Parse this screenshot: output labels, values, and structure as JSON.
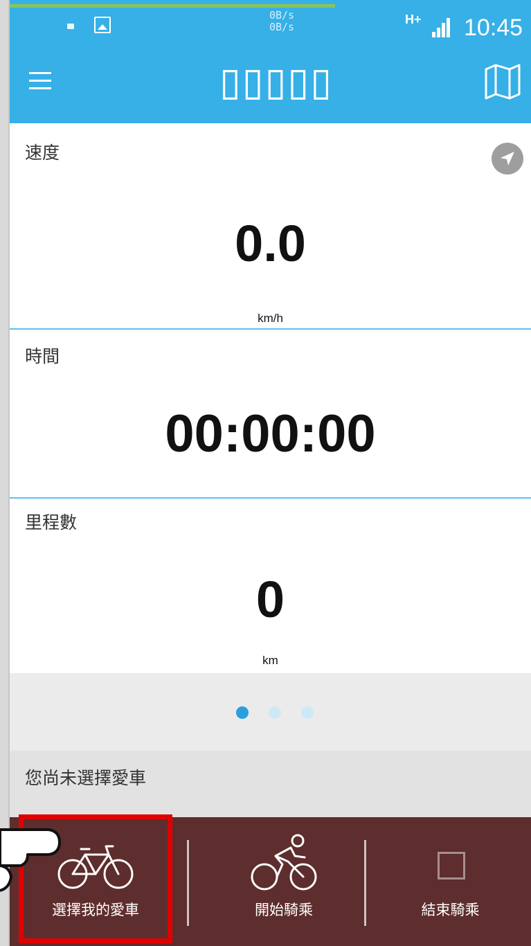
{
  "status_bar": {
    "net_speed_up": "0B/s",
    "net_speed_down": "0B/s",
    "net_type": "H+",
    "time": "10:45"
  },
  "app_bar": {
    "title": "▯▯▯▯▯",
    "menu_icon": "hamburger-menu-icon",
    "map_icon": "folded-map-icon"
  },
  "cards": {
    "speed": {
      "label": "速度",
      "value": "0.0",
      "unit": "km/h"
    },
    "time": {
      "label": "時間",
      "value": "00:00:00"
    },
    "distance": {
      "label": "里程數",
      "value": "0",
      "unit": "km"
    }
  },
  "pager": {
    "count": 3,
    "active_index": 0
  },
  "bike_status": {
    "text": "您尚未選擇愛車"
  },
  "actions": [
    {
      "label": "選擇我的愛車",
      "icon": "bicycle-icon"
    },
    {
      "label": "開始騎乘",
      "icon": "cyclist-icon"
    },
    {
      "label": "結束騎乘",
      "icon": "stop-square-icon"
    }
  ],
  "colors": {
    "app_bar": "#36b0e6",
    "divider": "#5cc1ea",
    "pager_active": "#2b9fde",
    "pager_inactive": "#cfe8f5",
    "action_bar": "#5e2d2d",
    "highlight": "#e10000"
  }
}
